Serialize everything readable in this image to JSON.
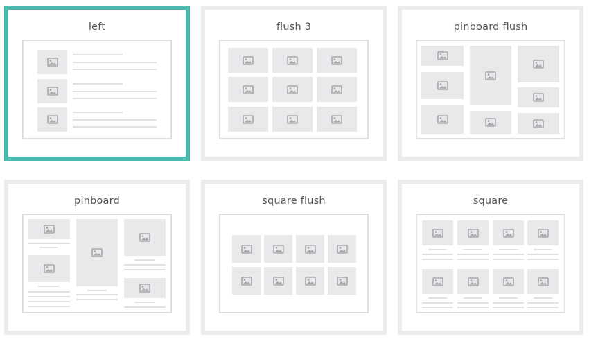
{
  "layouts": [
    {
      "id": "left",
      "label": "left",
      "selected": true,
      "card_name": "layout-option-left"
    },
    {
      "id": "flush3",
      "label": "flush 3",
      "selected": false,
      "card_name": "layout-option-flush-3"
    },
    {
      "id": "pinboard-flush",
      "label": "pinboard flush",
      "selected": false,
      "card_name": "layout-option-pinboard-flush"
    },
    {
      "id": "pinboard",
      "label": "pinboard",
      "selected": false,
      "card_name": "layout-option-pinboard"
    },
    {
      "id": "square-flush",
      "label": "square flush",
      "selected": false,
      "card_name": "layout-option-square-flush"
    },
    {
      "id": "square",
      "label": "square",
      "selected": false,
      "card_name": "layout-option-square"
    }
  ],
  "colors": {
    "selected_border": "#49b8ad",
    "card_border": "#ececec",
    "thumb_fill": "#e9e8ea",
    "icon": "#a9a8ab"
  },
  "icons": {
    "thumbnail": "image-icon"
  }
}
